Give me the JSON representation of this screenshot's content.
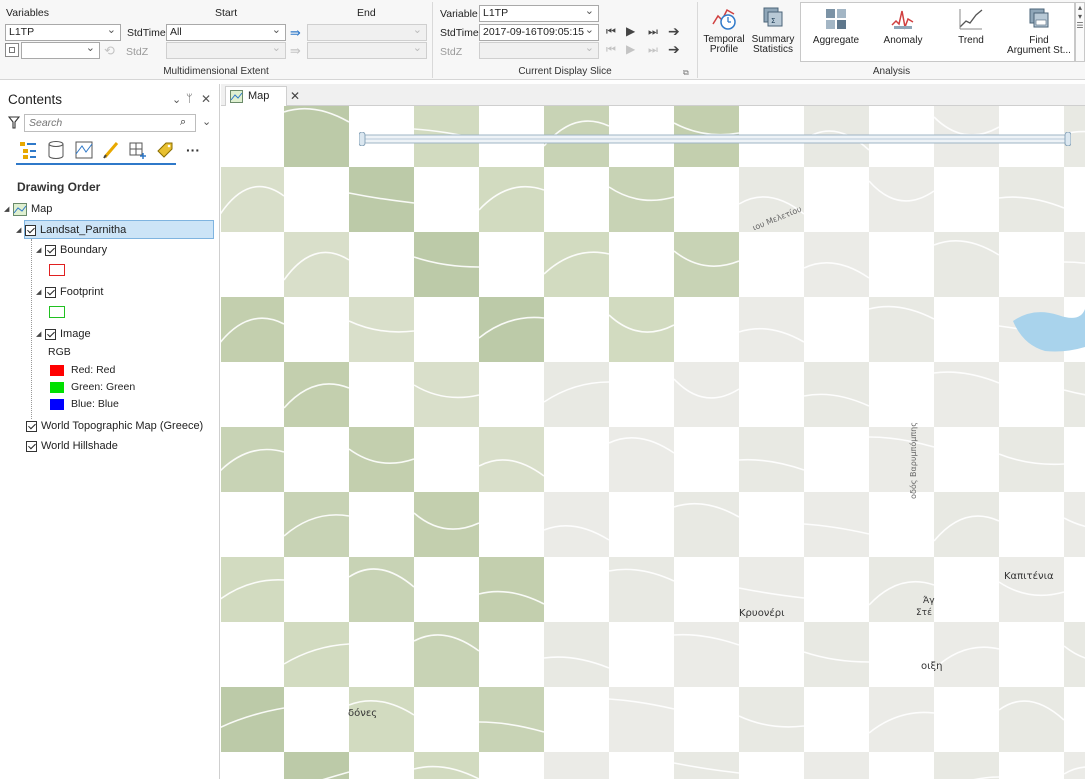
{
  "ribbon": {
    "multidim": {
      "group_label": "Multidimensional Extent",
      "variables_label": "Variables",
      "start_label": "Start",
      "end_label": "End",
      "variables_value": "L1TP",
      "stdtime_label": "StdTime",
      "stdtime_value": "All",
      "stdz_label": "StdZ"
    },
    "display_slice": {
      "group_label": "Current Display Slice",
      "variable_label": "Variable",
      "variable_value": "L1TP",
      "stdtime_label": "StdTime",
      "stdtime_value": "2017-09-16T09:05:15",
      "stdz_label": "StdZ"
    },
    "analysis": {
      "group_label": "Analysis",
      "temporal_profile": [
        "Temporal",
        "Profile"
      ],
      "summary_statistics": [
        "Summary",
        "Statistics"
      ],
      "aggregate": "Aggregate",
      "anomaly": "Anomaly",
      "trend": "Trend",
      "find_argument": [
        "Find",
        "Argument St..."
      ]
    }
  },
  "contents": {
    "title": "Contents",
    "search_placeholder": "Search",
    "drawing_order": "Drawing Order",
    "map_label": "Map",
    "layer_main": "Landsat_Parnitha",
    "boundary": "Boundary",
    "footprint": "Footprint",
    "image": "Image",
    "rgb": "RGB",
    "red": "Red:  Red",
    "green": "Green: Green",
    "blue": "Blue:  Blue",
    "layer_topo": "World Topographic Map (Greece)",
    "layer_hillshade": "World Hillshade"
  },
  "map_tab": {
    "label": "Map"
  },
  "map_labels": {
    "kryoneri": "Κρυονέρι",
    "kapitenia": "Καπιτένια",
    "meletiou": "ιου Μελετίου",
    "varimpompis": "οδός Βαρυμπόμπης",
    "doxes": "δόνες",
    "voixi": "οιξη",
    "ag": "Άγ",
    "ste": "Στέ"
  },
  "colors": {
    "red": "#ff0000",
    "green": "#00e000",
    "blue": "#0000ff",
    "boundary_outline": "#e02020",
    "footprint_outline": "#20c020",
    "selection": "#cce4f7"
  }
}
